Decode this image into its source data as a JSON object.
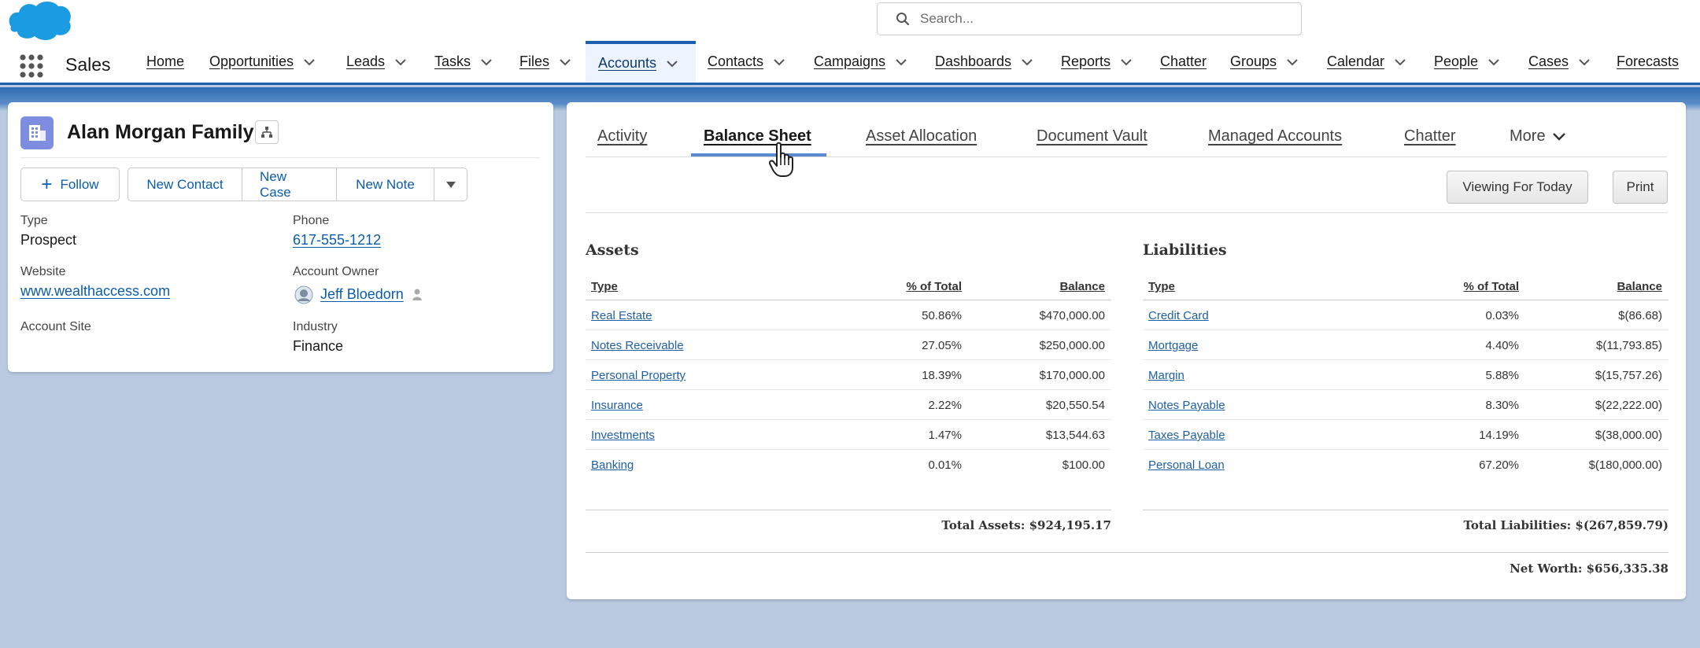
{
  "header": {
    "search_placeholder": "Search...",
    "brand_color": "#1b9ce2"
  },
  "nav": {
    "app_name": "Sales",
    "items": [
      {
        "label": "Home"
      },
      {
        "label": "Opportunities"
      },
      {
        "label": "Leads"
      },
      {
        "label": "Tasks"
      },
      {
        "label": "Files"
      },
      {
        "label": "Accounts"
      },
      {
        "label": "Contacts"
      },
      {
        "label": "Campaigns"
      },
      {
        "label": "Dashboards"
      },
      {
        "label": "Reports"
      },
      {
        "label": "Chatter"
      },
      {
        "label": "Groups"
      },
      {
        "label": "Calendar"
      },
      {
        "label": "People"
      },
      {
        "label": "Cases"
      },
      {
        "label": "Forecasts"
      }
    ],
    "active_item": "Accounts",
    "accent_color": "#1b5fae"
  },
  "record": {
    "title": "Alan Morgan Family",
    "actions": {
      "follow": "Follow",
      "new_contact": "New Contact",
      "new_case": "New Case",
      "new_note": "New Note"
    },
    "fields": {
      "type_label": "Type",
      "type_value": "Prospect",
      "phone_label": "Phone",
      "phone_value": "617-555-1212",
      "website_label": "Website",
      "website_value": "www.wealthaccess.com",
      "owner_label": "Account Owner",
      "owner_value": "Jeff Bloedorn",
      "site_label": "Account Site",
      "industry_label": "Industry",
      "industry_value": "Finance"
    }
  },
  "tabs": {
    "items": [
      {
        "label": "Activity"
      },
      {
        "label": "Balance Sheet"
      },
      {
        "label": "Asset Allocation"
      },
      {
        "label": "Document Vault"
      },
      {
        "label": "Managed Accounts"
      },
      {
        "label": "Chatter"
      }
    ],
    "more": "More",
    "active": "Balance Sheet"
  },
  "toolbar": {
    "viewing": "Viewing For Today",
    "print": "Print"
  },
  "balance_sheet": {
    "columns": {
      "type": "Type",
      "pct": "% of Total",
      "balance": "Balance"
    },
    "assets": {
      "title": "Assets",
      "rows": [
        {
          "type": "Real Estate",
          "pct": "50.86%",
          "balance": "$470,000.00"
        },
        {
          "type": "Notes Receivable",
          "pct": "27.05%",
          "balance": "$250,000.00"
        },
        {
          "type": "Personal Property",
          "pct": "18.39%",
          "balance": "$170,000.00"
        },
        {
          "type": "Insurance",
          "pct": "2.22%",
          "balance": "$20,550.54"
        },
        {
          "type": "Investments",
          "pct": "1.47%",
          "balance": "$13,544.63"
        },
        {
          "type": "Banking",
          "pct": "0.01%",
          "balance": "$100.00"
        }
      ],
      "total": "Total Assets: $924,195.17"
    },
    "liabilities": {
      "title": "Liabilities",
      "rows": [
        {
          "type": "Credit Card",
          "pct": "0.03%",
          "balance": "$(86.68)"
        },
        {
          "type": "Mortgage",
          "pct": "4.40%",
          "balance": "$(11,793.85)"
        },
        {
          "type": "Margin",
          "pct": "5.88%",
          "balance": "$(15,757.26)"
        },
        {
          "type": "Notes Payable",
          "pct": "8.30%",
          "balance": "$(22,222.00)"
        },
        {
          "type": "Taxes Payable",
          "pct": "14.19%",
          "balance": "$(38,000.00)"
        },
        {
          "type": "Personal Loan",
          "pct": "67.20%",
          "balance": "$(180,000.00)"
        }
      ],
      "total": "Total Liabilities: $(267,859.79)"
    },
    "net_worth": "Net Worth: $656,335.38"
  }
}
